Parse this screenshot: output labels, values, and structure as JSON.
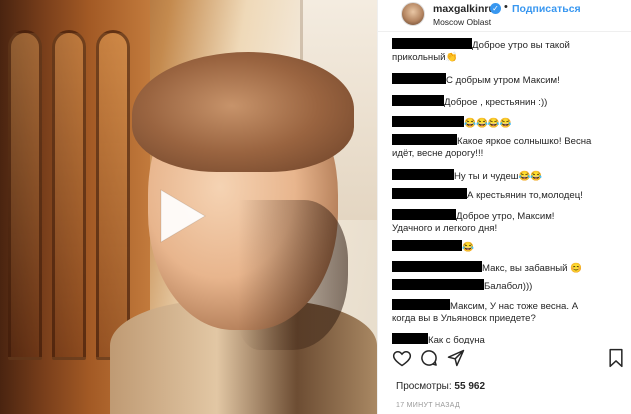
{
  "post": {
    "username": "maxgalkinru",
    "location": "Moscow Oblast",
    "follow_label": "Подписаться",
    "dot": "•",
    "verified_glyph": "✓"
  },
  "comments": [
    {
      "text": "Доброе утро вы такой"
    },
    {
      "text": "прикольный👏"
    },
    {
      "text": "С добрым утром Максим!"
    },
    {
      "text": "Доброе , крестьянин :))"
    },
    {
      "text": "😂😂😂😂"
    },
    {
      "text": "Какое яркое солнышко! Весна"
    },
    {
      "text": "идёт, весне дорогу!!!"
    },
    {
      "text": "Ну ты и чудеш😂😂"
    },
    {
      "text": "А крестьянин то,молодец!"
    },
    {
      "text": "Доброе утро, Максим!"
    },
    {
      "text": "Удачного и легкого дня!"
    },
    {
      "text": "😂"
    },
    {
      "text": "Макс, вы забавный 😊"
    },
    {
      "text": "Балабол)))"
    },
    {
      "text": "Максим, У нас тоже весна. А"
    },
    {
      "text": "когда вы в Ульяновск приедете?"
    },
    {
      "text": "Как с бодуна"
    }
  ],
  "stats": {
    "views_label": "Просмотры:",
    "views_value": "55 962",
    "time": "17 МИНУТ НАЗАД"
  },
  "icons": {
    "play": "play-icon",
    "like": "heart-icon",
    "comment": "comment-icon",
    "share": "share-icon",
    "save": "bookmark-icon"
  },
  "colors": {
    "accent": "#3897f0",
    "text": "#262626",
    "muted": "#999999"
  }
}
